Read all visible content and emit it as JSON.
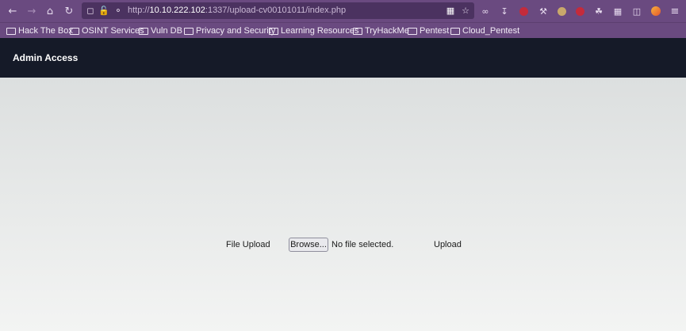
{
  "browser": {
    "url_prefix": "http://",
    "url_host": "10.10.222.102",
    "url_rest": ":1337/upload-cv00101011/index.php",
    "bookmarks": [
      "Hack The Box",
      "OSINT Services",
      "Vuln DB",
      "Privacy and Security",
      "Learning Resources",
      "TryHackMe",
      "Pentest",
      "Cloud_Pentest"
    ],
    "icons": [
      "back-icon",
      "forward-icon",
      "home-icon",
      "reload-icon",
      "shield-icon",
      "lock-icon",
      "key-icon",
      "qr-icon",
      "bookmark-star-icon",
      "mask-icon",
      "download-icon",
      "ublock-icon",
      "wrench-icon",
      "extension-icon",
      "extension-icon",
      "grid-icon",
      "puzzle-icon",
      "firefox-account-icon",
      "menu-icon"
    ]
  },
  "app": {
    "title": "Admin Access"
  },
  "form": {
    "file_label": "File Upload",
    "browse_label": "Browse...",
    "no_file_text": "No file selected.",
    "upload_label": "Upload"
  },
  "colors": {
    "toolbar": "#6a4a80",
    "urlbar": "#4b3260",
    "header": "#151a28",
    "page_bg": "#f3f4f3"
  }
}
